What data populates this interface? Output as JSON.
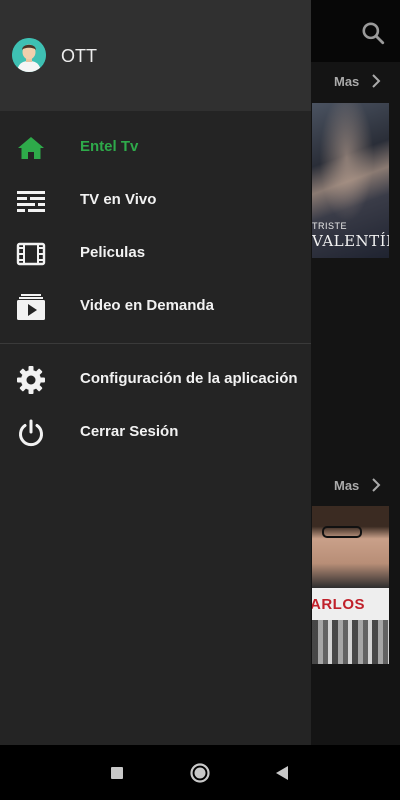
{
  "background": {
    "sections": [
      {
        "more_label": "Mas"
      },
      {
        "more_label": "Mas"
      }
    ],
    "posters": [
      {
        "title_line1": "TRISTE",
        "title_line2": "VALENTÍN"
      },
      {
        "title": "ARLOS"
      }
    ],
    "search_icon": "search-icon"
  },
  "drawer": {
    "user": {
      "name": "OTT",
      "avatar_icon": "user-avatar-icon"
    },
    "menu": [
      {
        "label": "Entel Tv",
        "icon": "home-icon",
        "active": true
      },
      {
        "label": "TV en Vivo",
        "icon": "live-tv-icon",
        "active": false
      },
      {
        "label": "Peliculas",
        "icon": "film-icon",
        "active": false
      },
      {
        "label": "Video en Demanda",
        "icon": "video-on-demand-icon",
        "active": false
      }
    ],
    "settings_menu": [
      {
        "label": "Configuración de la aplicación",
        "icon": "gear-icon"
      },
      {
        "label": "Cerrar Sesión",
        "icon": "power-icon"
      }
    ]
  },
  "colors": {
    "accent": "#2eaa4a",
    "drawer_bg": "#242424",
    "header_bg": "#303030"
  },
  "navbar": {
    "buttons": [
      "recents-icon",
      "home-circle-icon",
      "back-icon"
    ]
  }
}
